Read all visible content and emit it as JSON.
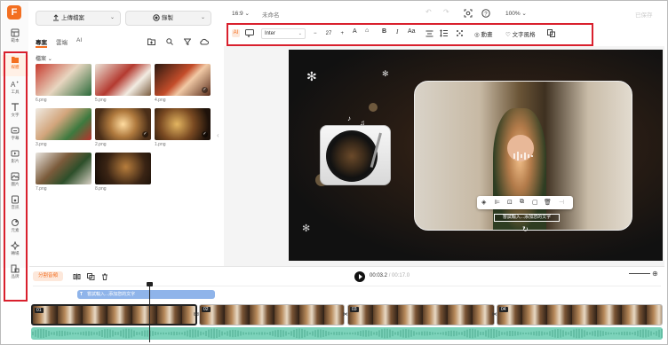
{
  "rail": {
    "items": [
      {
        "label": "範本",
        "icon": "template-icon"
      },
      {
        "label": "媒體",
        "icon": "media-icon",
        "active": true
      },
      {
        "label": "工具",
        "icon": "ai-tools-icon"
      },
      {
        "label": "文字",
        "icon": "text-icon"
      },
      {
        "label": "字幕",
        "icon": "subtitles-icon"
      },
      {
        "label": "影片",
        "icon": "video-icon"
      },
      {
        "label": "圖片",
        "icon": "image-icon"
      },
      {
        "label": "音訊",
        "icon": "audio-icon"
      },
      {
        "label": "元素",
        "icon": "elements-icon"
      },
      {
        "label": "轉場",
        "icon": "transition-icon"
      },
      {
        "label": "品牌",
        "icon": "brand-icon"
      }
    ]
  },
  "panel": {
    "upload_label": "上傳檔案",
    "record_label": "錄製",
    "tabs": [
      {
        "label": "專案"
      },
      {
        "label": "雲端"
      },
      {
        "label": "AI"
      }
    ],
    "folder_label": "檔案",
    "thumbnails": [
      {
        "name": "6.png"
      },
      {
        "name": "5.png"
      },
      {
        "name": "4.png"
      },
      {
        "name": "3.png"
      },
      {
        "name": "2.png"
      },
      {
        "name": "1.png"
      },
      {
        "name": "7.png"
      },
      {
        "name": "8.png"
      }
    ]
  },
  "topbar": {
    "aspect": "16:9",
    "project_name": "未命名",
    "zoom": "100%",
    "export_label": "已保存"
  },
  "text_toolbar": {
    "font": "Inter",
    "size": "27",
    "animation_label": "動畫",
    "style_label": "文字風格",
    "bold": "B",
    "italic": "I",
    "case": "Aa"
  },
  "canvas": {
    "subtitle_text": "嘗試輸入...添加您的文字"
  },
  "timeline": {
    "split_label": "分割音頻",
    "current_time": "00:03.2",
    "total_time": "/ 00:17.0",
    "text_track_label": "嘗試輸入...添加您的文字",
    "clips": [
      {
        "num": "01"
      },
      {
        "num": "02"
      },
      {
        "num": "03"
      },
      {
        "num": "04"
      }
    ]
  },
  "colors": {
    "accent": "#f36f21",
    "highlight_box": "#d9202d",
    "audio_track": "#7dd3bb",
    "text_track": "#8fb4ea"
  }
}
